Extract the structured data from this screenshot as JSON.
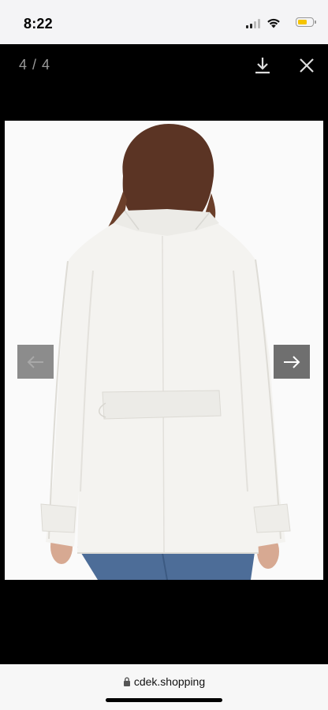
{
  "status_bar": {
    "time": "8:22",
    "battery_color": "#f5c400",
    "icons": [
      "signal-icon",
      "wifi-icon",
      "battery-icon"
    ]
  },
  "viewer": {
    "counter": "4 / 4",
    "download_icon": "download-icon",
    "close_icon": "close-icon",
    "prev_icon": "arrow-left-icon",
    "next_icon": "arrow-right-icon"
  },
  "url_bar": {
    "domain": "cdek.shopping",
    "lock_icon": "lock-icon"
  }
}
